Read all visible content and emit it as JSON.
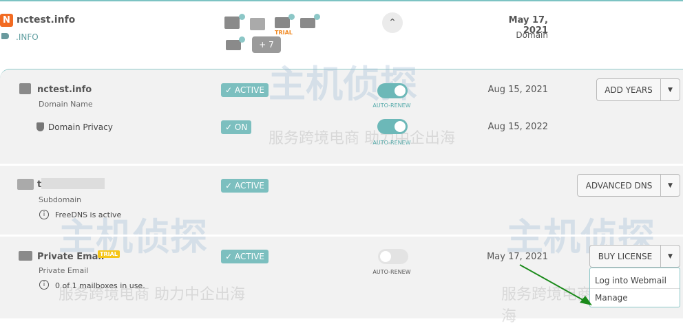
{
  "header": {
    "logo": "N",
    "domain": "nctest.info",
    "tld": ".INFO",
    "trial": "TRIAL",
    "more": "+ 7",
    "date": "May 17, 2021",
    "type": "Domain"
  },
  "rows": [
    {
      "name": "nctest.info",
      "sub": "Domain Name",
      "status": "ACTIVE",
      "toggle": "AUTO-RENEW",
      "date": "Aug 15, 2021",
      "button": "ADD YEARS"
    },
    {
      "name": "Domain Privacy",
      "status": "ON",
      "toggle": "AUTO-RENEW",
      "date": "Aug 15, 2022"
    },
    {
      "name": "t",
      "sub": "Subdomain",
      "info": "FreeDNS is active",
      "status": "ACTIVE",
      "button": "ADVANCED DNS"
    },
    {
      "name": "Private Email",
      "badge": "TRIAL",
      "sub": "Private Email",
      "info": "0 of 1 mailboxes in use.",
      "status": "ACTIVE",
      "toggle": "AUTO-RENEW",
      "date": "May 17, 2021",
      "button": "BUY LICENSE"
    }
  ],
  "dropdown": [
    "Log into Webmail",
    "Manage"
  ],
  "watermark": {
    "main": "主机侦探",
    "sub": "服务跨境电商 助力中企出海"
  },
  "colors": {
    "accent": "#7cbfbf",
    "brand": "#f26b22",
    "trial": "#f08a24"
  }
}
